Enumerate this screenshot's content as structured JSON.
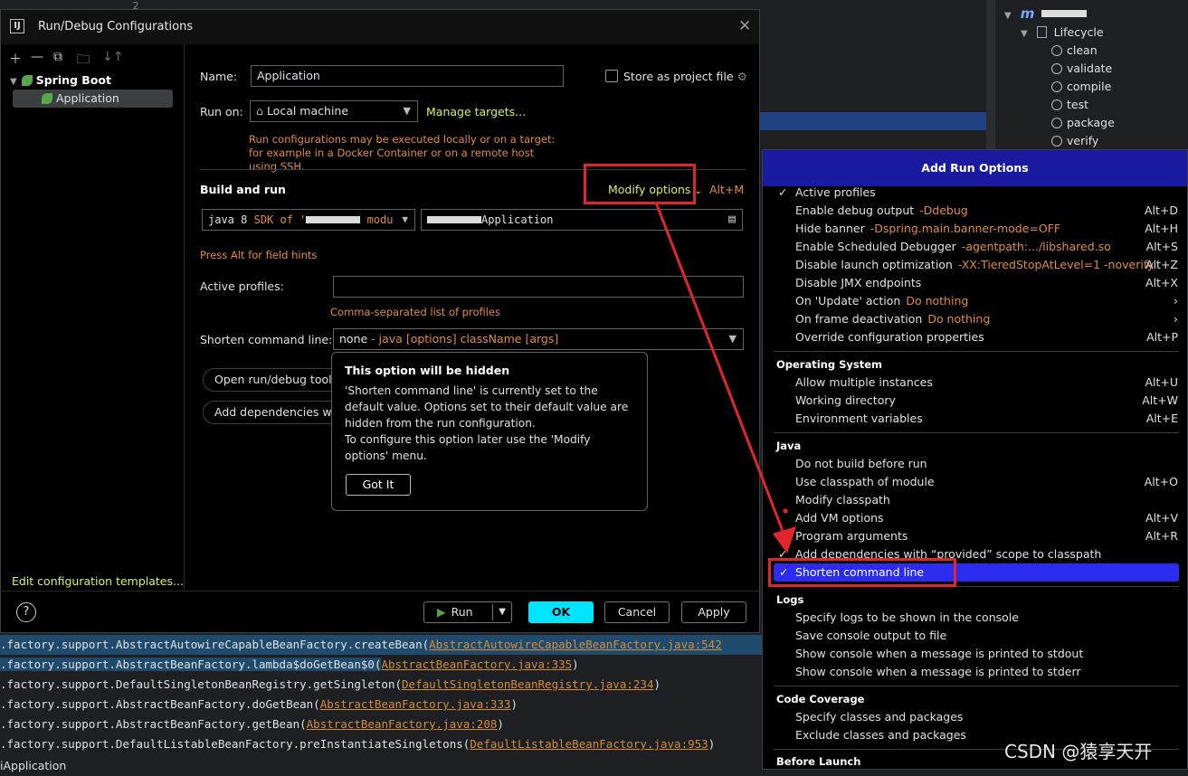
{
  "bg": {
    "line_number": "2"
  },
  "maven": {
    "project_prefix": "m",
    "lifecycle": "Lifecycle",
    "goals": [
      "clean",
      "validate",
      "compile",
      "test",
      "package",
      "verify"
    ]
  },
  "console": {
    "lines": [
      {
        "text": ".factory.support.AbstractAutowireCapableBeanFactory.createBean(",
        "link": "AbstractAutowireCapableBeanFactory.java:542"
      },
      {
        "text": ".factory.support.AbstractBeanFactory.lambda$doGetBean$0(",
        "link": "AbstractBeanFactory.java:335",
        "close": ")"
      },
      {
        "text": ".factory.support.DefaultSingletonBeanRegistry.getSingleton(",
        "link": "DefaultSingletonBeanRegistry.java:234",
        "close": ")"
      },
      {
        "text": ".factory.support.AbstractBeanFactory.doGetBean(",
        "link": "AbstractBeanFactory.java:333",
        "close": ")"
      },
      {
        "text": ".factory.support.AbstractBeanFactory.getBean(",
        "link": "AbstractBeanFactory.java:208",
        "close": ")"
      },
      {
        "text": ".factory.support.DefaultListableBeanFactory.preInstantiateSingletons(",
        "link": "DefaultListableBeanFactory.java:953",
        "close": ")"
      }
    ],
    "bottom_line": "iApplication"
  },
  "dialog": {
    "title": "Run/Debug Configurations",
    "app_logo": "IJ",
    "tree": {
      "group": "Spring Boot",
      "item": "Application"
    },
    "edit_templates": "Edit configuration templates...",
    "name_label": "Name:",
    "name_value": "Application",
    "store_label": "Store as project file",
    "run_on_label": "Run on:",
    "run_on_value": "Local machine",
    "manage_targets": "Manage targets...",
    "run_on_hint": "Run configurations may be executed locally or on a target: for example in a Docker Container or on a remote host using SSH.",
    "build_run": "Build and run",
    "modify_options": "Modify options",
    "modify_shortcut": "Alt+M",
    "jdk_prefix": "java 8",
    "jdk_rest": "SDK of '",
    "jdk_suffix": "modu",
    "main_class": "Application",
    "alt_hint": "Press Alt for field hints",
    "active_profiles_label": "Active profiles:",
    "profiles_hint": "Comma-separated list of profiles",
    "shorten_label": "Shorten command line:",
    "shorten_value": "none",
    "shorten_hint": "- java [options] className [args]",
    "open_tool": "Open run/debug tool",
    "add_deps": "Add dependencies wit",
    "tooltip": {
      "title": "This option will be hidden",
      "body1": "'Shorten command line' is currently set to the default value. Options set to their default value are hidden from the run configuration.",
      "body2": "To configure this option later use the 'Modify options' menu.",
      "button": "Got It"
    },
    "buttons": {
      "run": "Run",
      "ok": "OK",
      "cancel": "Cancel",
      "apply": "Apply"
    }
  },
  "popup": {
    "title": "Add Run Options",
    "items": [
      {
        "label": "Active profiles",
        "hint": "",
        "shortcut": "",
        "checked": true
      },
      {
        "label": "Enable debug output",
        "hint": "-Ddebug",
        "shortcut": "Alt+D"
      },
      {
        "label": "Hide banner",
        "hint": "-Dspring.main.banner-mode=OFF",
        "shortcut": "Alt+H"
      },
      {
        "label": "Enable Scheduled Debugger",
        "hint": "-agentpath:.../libshared.so",
        "shortcut": "Alt+S"
      },
      {
        "label": "Disable launch optimization",
        "hint": "-XX:TieredStopAtLevel=1 -noverify",
        "shortcut": "Alt+Z"
      },
      {
        "label": "Disable JMX endpoints",
        "hint": "",
        "shortcut": "Alt+X"
      },
      {
        "label": "On 'Update' action",
        "hint": "Do nothing",
        "shortcut": "›"
      },
      {
        "label": "On frame deactivation",
        "hint": "Do nothing",
        "shortcut": "›"
      },
      {
        "label": "Override configuration properties",
        "hint": "",
        "shortcut": "Alt+P"
      }
    ],
    "os_title": "Operating System",
    "os_items": [
      {
        "label": "Allow multiple instances",
        "shortcut": "Alt+U"
      },
      {
        "label": "Working directory",
        "shortcut": "Alt+W"
      },
      {
        "label": "Environment variables",
        "shortcut": "Alt+E"
      }
    ],
    "java_title": "Java",
    "java_items": [
      {
        "label": "Do not build before run",
        "shortcut": ""
      },
      {
        "label": "Use classpath of module",
        "shortcut": "Alt+O"
      },
      {
        "label": "Modify classpath",
        "shortcut": ""
      },
      {
        "label": "Add VM options",
        "shortcut": "Alt+V"
      },
      {
        "label": "Program arguments",
        "shortcut": "Alt+R"
      },
      {
        "label": "Add dependencies with “provided” scope to classpath",
        "shortcut": "",
        "checked": true
      },
      {
        "label": "Shorten command line",
        "shortcut": "",
        "checked": true,
        "highlighted": true
      }
    ],
    "logs_title": "Logs",
    "logs_items": [
      "Specify logs to be shown in the console",
      "Save console output to file",
      "Show console when a message is printed to stdout",
      "Show console when a message is printed to stderr"
    ],
    "coverage_title": "Code Coverage",
    "coverage_items": [
      "Specify classes and packages",
      "Exclude classes and packages"
    ],
    "before_title": "Before Launch"
  },
  "watermark": "CSDN @猿享天开",
  "colors": {
    "annotation_red": "#e0262b",
    "ok_button": "#00e5ff",
    "popup_header": "#1a1aa0",
    "highlight": "#2c2cf0"
  }
}
